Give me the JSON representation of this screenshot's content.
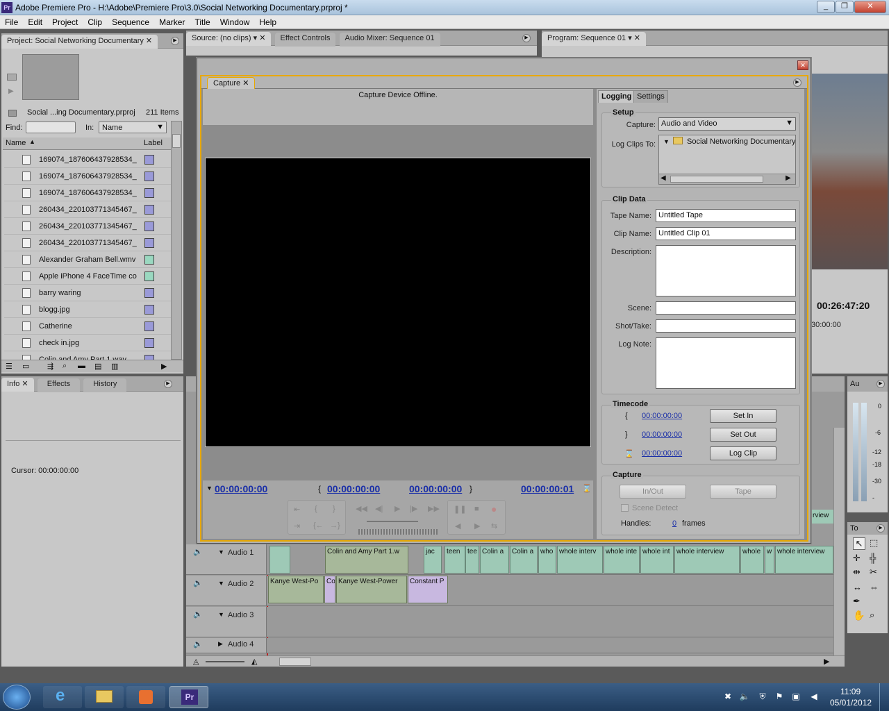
{
  "window": {
    "title": "Adobe Premiere Pro - H:\\Adobe\\Premiere Pro\\3.0\\Social Networking Documentary.prproj *",
    "app_icon": "Pr"
  },
  "menu": [
    "File",
    "Edit",
    "Project",
    "Clip",
    "Sequence",
    "Marker",
    "Title",
    "Window",
    "Help"
  ],
  "project": {
    "tab": "Project: Social Networking Documentary",
    "file": "Social ...ing Documentary.prproj",
    "count": "211 Items",
    "find_label": "Find:",
    "in_label": "In:",
    "in_value": "Name",
    "col_name": "Name",
    "col_label": "Label",
    "items": [
      {
        "name": "169074_187606437928534_",
        "color": "#9a9ad8"
      },
      {
        "name": "169074_187606437928534_",
        "color": "#9a9ad8"
      },
      {
        "name": "169074_187606437928534_",
        "color": "#9a9ad8"
      },
      {
        "name": "260434_220103771345467_",
        "color": "#9a9ad8"
      },
      {
        "name": "260434_220103771345467_",
        "color": "#9a9ad8"
      },
      {
        "name": "260434_220103771345467_",
        "color": "#9a9ad8"
      },
      {
        "name": "Alexander Graham Bell.wmv",
        "color": "#9ad8c0"
      },
      {
        "name": "Apple iPhone 4 FaceTime co",
        "color": "#9ad8c0"
      },
      {
        "name": "barry waring",
        "color": "#9a9ad8"
      },
      {
        "name": "blogg.jpg",
        "color": "#9a9ad8"
      },
      {
        "name": "Catherine",
        "color": "#9a9ad8"
      },
      {
        "name": "check in.jpg",
        "color": "#9a9ad8"
      },
      {
        "name": "Colin and Amy Part 1.wav",
        "color": "#9a9ad8"
      }
    ]
  },
  "source_tabs": [
    "Source: (no clips)",
    "Effect Controls",
    "Audio Mixer: Sequence 01"
  ],
  "program": {
    "tab": "Program: Sequence 01",
    "timecode": "00:26:47:20",
    "ruler": "30:00:00"
  },
  "info": {
    "tabs": [
      "Info",
      "Effects",
      "History"
    ],
    "cursor": "Cursor:  00:00:00:00"
  },
  "capture": {
    "tab": "Capture",
    "status": "Capture Device Offline.",
    "tabs": [
      "Logging",
      "Settings"
    ],
    "setup": {
      "title": "Setup",
      "capture_label": "Capture:",
      "capture_value": "Audio and Video",
      "log_label": "Log Clips To:",
      "log_value": "Social Networking Documentary"
    },
    "clipdata": {
      "title": "Clip Data",
      "tape_label": "Tape Name:",
      "tape_value": "Untitled Tape",
      "clip_label": "Clip Name:",
      "clip_value": "Untitled Clip 01",
      "desc_label": "Description:",
      "scene_label": "Scene:",
      "shot_label": "Shot/Take:",
      "note_label": "Log Note:"
    },
    "timecode": {
      "title": "Timecode",
      "in": "00:00:00:00",
      "out": "00:00:00:00",
      "dur": "00:00:00:00",
      "set_in": "Set In",
      "set_out": "Set Out",
      "log_clip": "Log Clip"
    },
    "cap": {
      "title": "Capture",
      "inout": "In/Out",
      "tape": "Tape",
      "scene_detect": "Scene Detect",
      "handles_label": "Handles:",
      "handles_value": "0",
      "frames": "frames"
    },
    "bottom_tc": [
      "00:00:00:00",
      "00:00:00:00",
      "00:00:00:00",
      "00:00:00:01"
    ]
  },
  "timeline": {
    "tracks": [
      "Audio 1",
      "Audio 2",
      "Audio 3",
      "Audio 4"
    ],
    "a1_clips": [
      "Colin and Amy Part 1.w",
      "jac",
      "teen",
      "tee",
      "Colin a",
      "Colin a",
      "who",
      "whole interv",
      "whole inte",
      "whole int",
      "whole interview",
      "whole",
      "w",
      "whole interview"
    ],
    "a2_clips": [
      "Kanye West-Po",
      "Co",
      "Kanye West-Power",
      "Constant P"
    ],
    "right_clip": "rview"
  },
  "meter": {
    "label": "Au",
    "ticks": [
      "0",
      "-6",
      "-12",
      "-18",
      "-30",
      "-"
    ]
  },
  "tools": {
    "label": "To"
  },
  "taskbar": {
    "time": "11:09",
    "date": "05/01/2012"
  }
}
